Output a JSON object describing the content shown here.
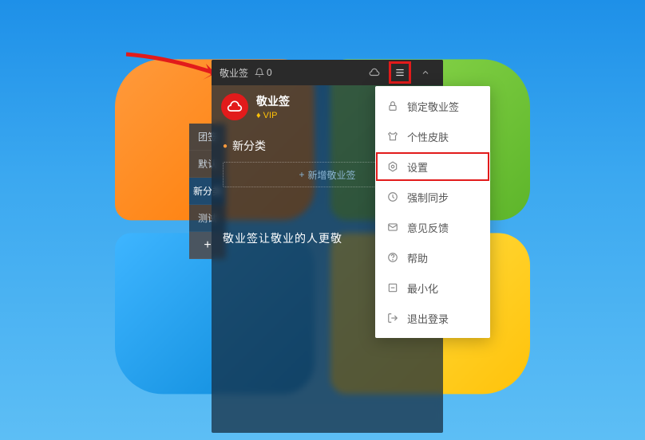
{
  "titlebar": {
    "app_name": "敬业签",
    "notification_count": "0"
  },
  "user": {
    "name": "敬业签",
    "vip_label": "VIP"
  },
  "tabs": [
    {
      "label": "团签"
    },
    {
      "label": "默认"
    },
    {
      "label": "新分类",
      "active": true
    },
    {
      "label": "测试"
    },
    {
      "label": "+"
    }
  ],
  "category": {
    "label": "新分类"
  },
  "addbox": {
    "label": "新增敬业签",
    "plus": "+"
  },
  "slogan": "敬业签让敬业的人更敬",
  "menu": [
    {
      "icon": "lock-icon",
      "label": "锁定敬业签"
    },
    {
      "icon": "skin-icon",
      "label": "个性皮肤"
    },
    {
      "icon": "settings-icon",
      "label": "设置",
      "highlight": true
    },
    {
      "icon": "sync-icon",
      "label": "强制同步"
    },
    {
      "icon": "feedback-icon",
      "label": "意见反馈"
    },
    {
      "icon": "help-icon",
      "label": "帮助"
    },
    {
      "icon": "minimize-icon",
      "label": "最小化"
    },
    {
      "icon": "logout-icon",
      "label": "退出登录"
    }
  ]
}
